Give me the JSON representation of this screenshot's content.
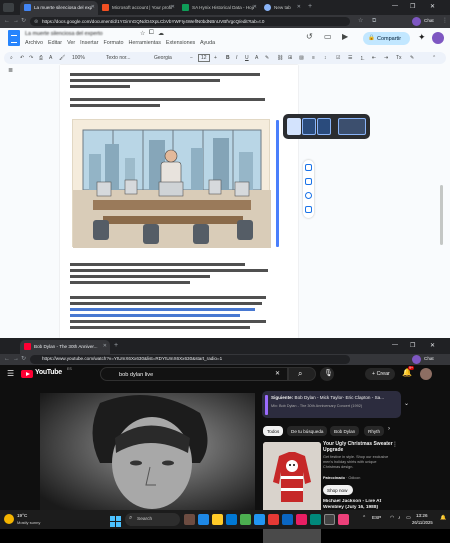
{
  "browser_top": {
    "tabs": [
      {
        "title": "La muerte silenciosa del experto",
        "favicon_color": "#4285f4"
      },
      {
        "title": "Microsoft account | Your profile",
        "favicon_color": "#f25022"
      },
      {
        "title": "SA Hynix Historical Data - Hojas",
        "favicon_color": "#0f9d58"
      },
      {
        "title": "New tab",
        "favicon_color": "#8ab4f8"
      }
    ],
    "url": "https://docs.google.com/document/d/1YGirmGQNdO4XpLCbVbYWFIy4WeflN0bdNBnUVBfVgcQ/edit?tab=t.0",
    "avatar": "Chat"
  },
  "docs": {
    "title": "La muerte silenciosa del experto",
    "menu": [
      "Archivo",
      "Editar",
      "Ver",
      "Insertar",
      "Formato",
      "Herramientas",
      "Extensiones",
      "Ayuda"
    ],
    "share_label": "Compartir",
    "toolbar": {
      "zoom": "100%",
      "style": "Texto nor...",
      "font": "Georgia",
      "font_size": "12",
      "minus": "−",
      "plus": "+"
    },
    "accent": "#c2e7ff"
  },
  "browser_bottom": {
    "tab": {
      "title": "Bob Dylan - The 30th Anniver..."
    },
    "url": "https://www.youtube.com/watch?v=YtUmX6Xx630&list=RDYtUmX6Xx630&start_radio=1",
    "avatar": "Chat"
  },
  "youtube": {
    "logo_text": "YouTube",
    "country": "ES",
    "search_value": "bob dylan live",
    "create_label": "+ Crear",
    "notifications": "9+",
    "next_label": "Siguiente:",
    "next_title": "Bob Dylan - Mick Taylor- Eric Clapton - Sa...",
    "next_sub": "Mix: Bob Dylan - The 30th Anniversary Concert (1992)",
    "chips": [
      "Todos",
      "De tu búsqueda",
      "Bob Dylan",
      "Rhyth"
    ],
    "ad": {
      "title": "Your Ugly Christmas Sweater Upgrade",
      "body": "Get festive in style. Shop our exclusive men's holiday shirts with unique Christmas design.",
      "sponsor_label": "Patrocinado",
      "advertiser": "Odicon",
      "cta": "Shop now"
    },
    "next_video": {
      "title": "Michael Jackson - Live At",
      "sub": "Wembley (July 16, 1988)"
    }
  },
  "taskbar": {
    "weather": "19°C",
    "condition": "Mostly sunny",
    "search_placeholder": "Search",
    "time": "13:26",
    "date": "26/11/2025",
    "lang": "ESP"
  }
}
